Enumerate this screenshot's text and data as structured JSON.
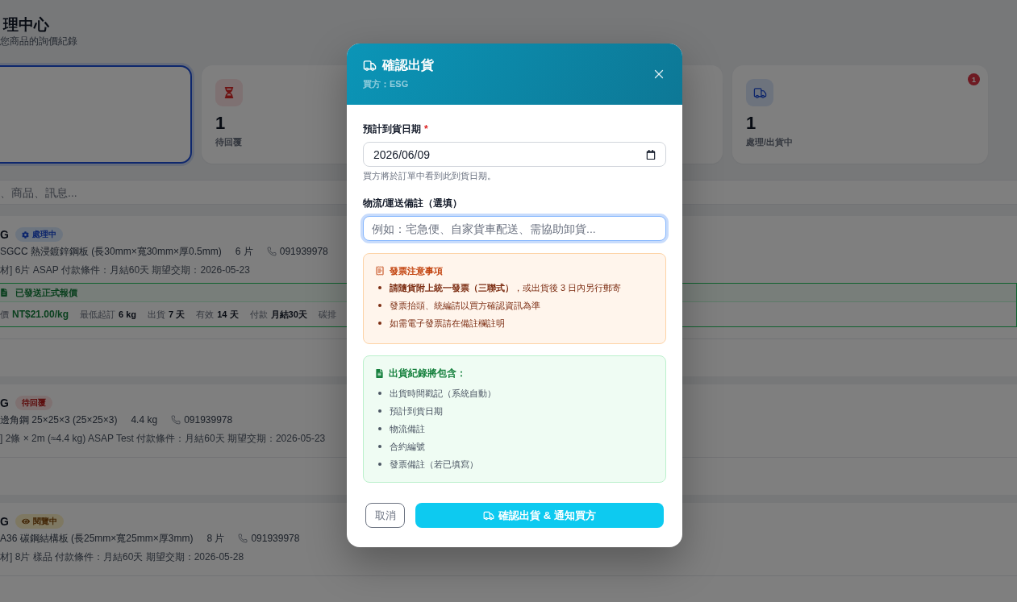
{
  "page": {
    "title": "理中心",
    "subtitle": "您商品的詢價紀錄"
  },
  "stats": [
    {
      "kind": "blank",
      "selected": true
    },
    {
      "kind": "pending",
      "value": "1",
      "label": "待回覆",
      "selected": false
    },
    {
      "kind": "blank",
      "selected": false
    },
    {
      "kind": "shipping",
      "value": "1",
      "label": "處理/出貨中",
      "badge": "1",
      "selected": false
    }
  ],
  "search": {
    "placeholder": "、商品、訊息..."
  },
  "inquiries": [
    {
      "buyer": "G",
      "status": {
        "kind": "processing",
        "label": "處理中"
      },
      "product": "SGCC 熱浸鍍鋅鋼板 (長30mm×寬30mm×厚0.5mm)",
      "quantity": "6 片",
      "phone": "091939978",
      "note": "材] 6片 ASAP 付款條件：月結60天 期望交期：2026-05-23",
      "quote": {
        "title": "已發送正式報價",
        "terms": [
          {
            "kind": "price",
            "label": "價",
            "value": "NT$21.00/kg"
          },
          {
            "kind": "plain",
            "label": "最低起訂",
            "value": "6 kg"
          },
          {
            "kind": "plain",
            "label": "出貨",
            "value": "7 天"
          },
          {
            "kind": "plain",
            "label": "有效",
            "value": "14 天"
          },
          {
            "kind": "plain",
            "label": "付款",
            "value": "月結30天"
          },
          {
            "kind": "plain",
            "label": "碳排"
          }
        ]
      }
    },
    {
      "buyer": "G",
      "status": {
        "kind": "pending",
        "label": "待回覆"
      },
      "product": "邊角鋼 25×25×3 (25×25×3)",
      "quantity": "4.4 kg",
      "phone": "091939978",
      "note": "] 2條 × 2m (≈4.4 kg) ASAP Test 付款條件：月結60天 期望交期：2026-05-23"
    },
    {
      "buyer": "G",
      "status": {
        "kind": "viewing",
        "label": "閱覽中"
      },
      "product": "A36 碳鋼結構板 (長25mm×寬25mm×厚3mm)",
      "quantity": "8 片",
      "phone": "091939978",
      "note": "材] 8片 樣品 付款條件：月結60天 期望交期：2026-05-28"
    }
  ],
  "dialog": {
    "title": "確認出貨",
    "subtitle": "買方：ESG",
    "fields": [
      {
        "kind": "date",
        "label": "預計到貨日期",
        "required_mark": "*",
        "value": "2026/06/09",
        "help": "買方將於訂單中看到此到貨日期。",
        "focused": false
      },
      {
        "kind": "text",
        "label": "物流/運送備註（選填）",
        "placeholder": "例如：宅急便、自家貨車配送、需協助卸貨...",
        "focused": true
      }
    ],
    "notices": [
      {
        "kind": "warning",
        "title": "發票注意事項",
        "items": [
          "**請隨貨附上統一發票（三聯式）**，或出貨後 3 日內另行郵寄",
          "發票抬頭、統編請以買方確認資訊為準",
          "如需電子發票請在備註欄註明"
        ]
      },
      {
        "kind": "success",
        "title": "出貨紀錄將包含：",
        "items": [
          "出貨時間戳記（系統自動）",
          "預計到貨日期",
          "物流備註",
          "合約編號",
          "發票備註（若已填寫）"
        ]
      }
    ],
    "buttons": [
      {
        "kind": "secondary",
        "label": "取消"
      },
      {
        "kind": "primary",
        "label": "確認出貨 & 通知買方"
      }
    ]
  }
}
